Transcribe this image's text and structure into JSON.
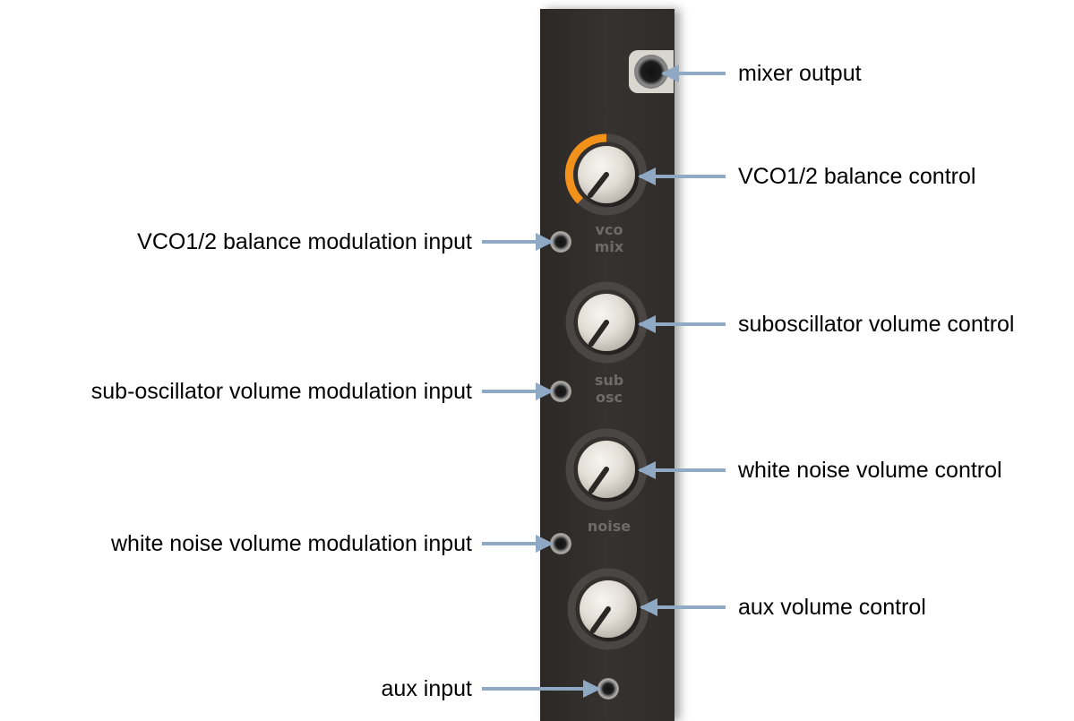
{
  "panel": {
    "labels": {
      "vco_mix": [
        "vco",
        "mix"
      ],
      "sub_osc": [
        "sub",
        "osc"
      ],
      "noise": [
        "noise"
      ]
    },
    "knobs": [
      {
        "id": "vco-mix",
        "value": 0.3,
        "ring_active": true
      },
      {
        "id": "sub-osc",
        "value": 0.2,
        "ring_active": false
      },
      {
        "id": "noise",
        "value": 0.2,
        "ring_active": false
      },
      {
        "id": "aux",
        "value": 0.2,
        "ring_active": false
      }
    ]
  },
  "annotations": {
    "mixer_output": "mixer output",
    "vco_balance_control": "VCO1/2 balance control",
    "vco_balance_mod_input": "VCO1/2 balance modulation input",
    "suboscillator_volume_control": "suboscillator volume control",
    "suboscillator_volume_mod_input": "sub-oscillator volume modulation input",
    "white_noise_volume_control": "white noise volume control",
    "white_noise_volume_mod_input": "white noise volume modulation input",
    "aux_volume_control": "aux volume control",
    "aux_input": "aux input"
  },
  "colors": {
    "panel": "#332f2d",
    "arrow": "#8fa8c4",
    "ring_active": "#f2921b",
    "ring_inactive": "#4a4643",
    "knob_face": "#e4e0d8",
    "panel_text": "#6e6a66"
  }
}
